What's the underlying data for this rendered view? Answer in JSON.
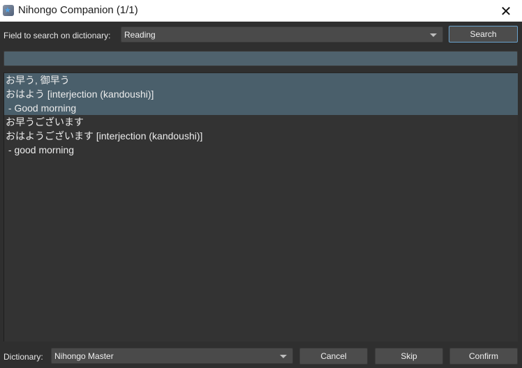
{
  "window": {
    "title": "Nihongo Companion (1/1)",
    "app_icon": "app-star-icon",
    "close_icon": "✕"
  },
  "search": {
    "field_label": "Field to search on dictionary:",
    "field_value": "Reading",
    "search_button": "Search",
    "query_value": "",
    "query_placeholder": ""
  },
  "results": [
    {
      "selected": true,
      "kanji": "お早う, 御早う",
      "reading": "おはよう [interjection (kandoushi)]",
      "meaning": " - Good morning"
    },
    {
      "selected": false,
      "kanji": "お早うございます",
      "reading": "おはようございます [interjection (kandoushi)]",
      "meaning": " - good morning"
    }
  ],
  "footer": {
    "dictionary_label": "Dictionary:",
    "dictionary_value": "Nihongo Master",
    "cancel_button": "Cancel",
    "skip_button": "Skip",
    "confirm_button": "Confirm"
  },
  "colors": {
    "selection": "#4a5f6b",
    "focus_border": "#6aa2cc",
    "background": "#2f2f2f"
  }
}
